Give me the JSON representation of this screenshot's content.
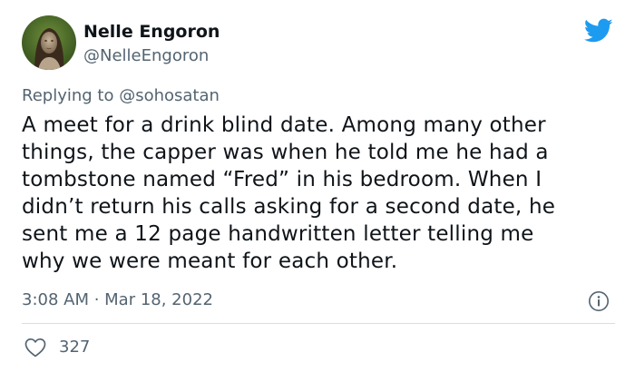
{
  "tweet": {
    "author": {
      "display_name": "Nelle Engoron",
      "handle": "@NelleEngoron",
      "avatar_icon": "avatar-portrait"
    },
    "brand_icon": "twitter-bird-icon",
    "reply": {
      "prefix": "Replying to ",
      "target": "@sohosatan"
    },
    "text_lines": [
      "A meet for a drink blind date. Among many other",
      "things, the capper was when he told me he had a",
      "tombstone named “Fred” in his bedroom. When I",
      "didn’t return his calls asking for a second date, he",
      "sent me a 12 page handwritten letter telling me",
      "why we were meant for each other."
    ],
    "timestamp": "3:08 AM · Mar 18, 2022",
    "info_icon": "info-icon",
    "likes": {
      "icon": "heart-icon",
      "count": "327"
    }
  },
  "colors": {
    "text_primary": "#0f1419",
    "text_secondary": "#536471",
    "brand_blue": "#1d9bf0",
    "divider": "#d9dee3"
  }
}
